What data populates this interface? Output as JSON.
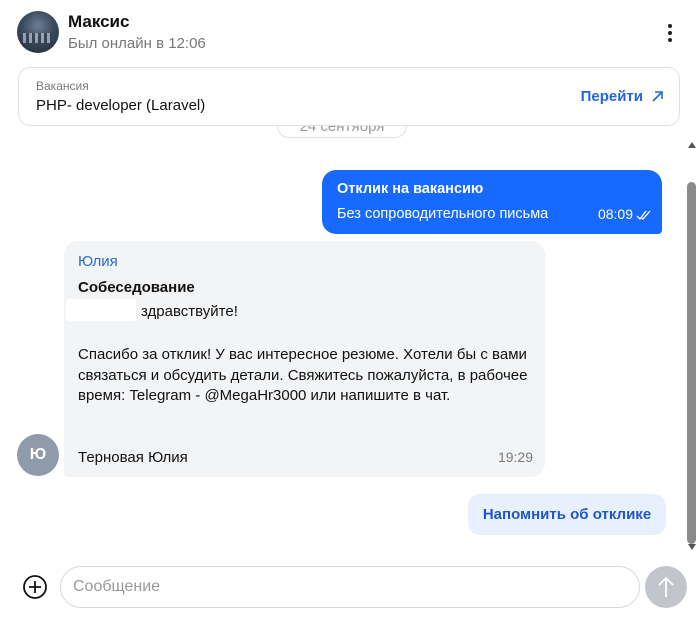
{
  "header": {
    "name": "Максис",
    "status": "Был онлайн в 12:06"
  },
  "vacancy": {
    "caption": "Вакансия",
    "title": "PHP- developer (Laravel)",
    "link_label": "Перейти"
  },
  "chat": {
    "date_chip": "24 сентября",
    "outgoing": {
      "title": "Отклик на вакансию",
      "text": "Без сопроводительного письма",
      "time": "08:09"
    },
    "incoming": {
      "avatar_initial": "Ю",
      "sender": "Юлия",
      "subject": "Собеседование",
      "greeting": "здравствуйте!",
      "body": "Спасибо за отклик! У вас интересное резюме. Хотели бы с вами связаться и обсудить детали. Свяжитесь пожалуйста, в рабочее время: Telegram - @MegaHr3000 или напишите в чат.",
      "signature": "Терновая Юлия",
      "time": "19:29"
    },
    "remind_button": "Напомнить об отклике"
  },
  "input": {
    "placeholder": "Сообщение"
  },
  "icons": {
    "menu": "more-vertical-icon",
    "link": "arrow-up-right-icon",
    "read": "double-check-icon",
    "attach": "plus-circle-icon",
    "send": "arrow-up-icon"
  },
  "colors": {
    "accent": "#1769ff",
    "link": "#2266dd",
    "bubble_in": "#f3f4f6"
  }
}
